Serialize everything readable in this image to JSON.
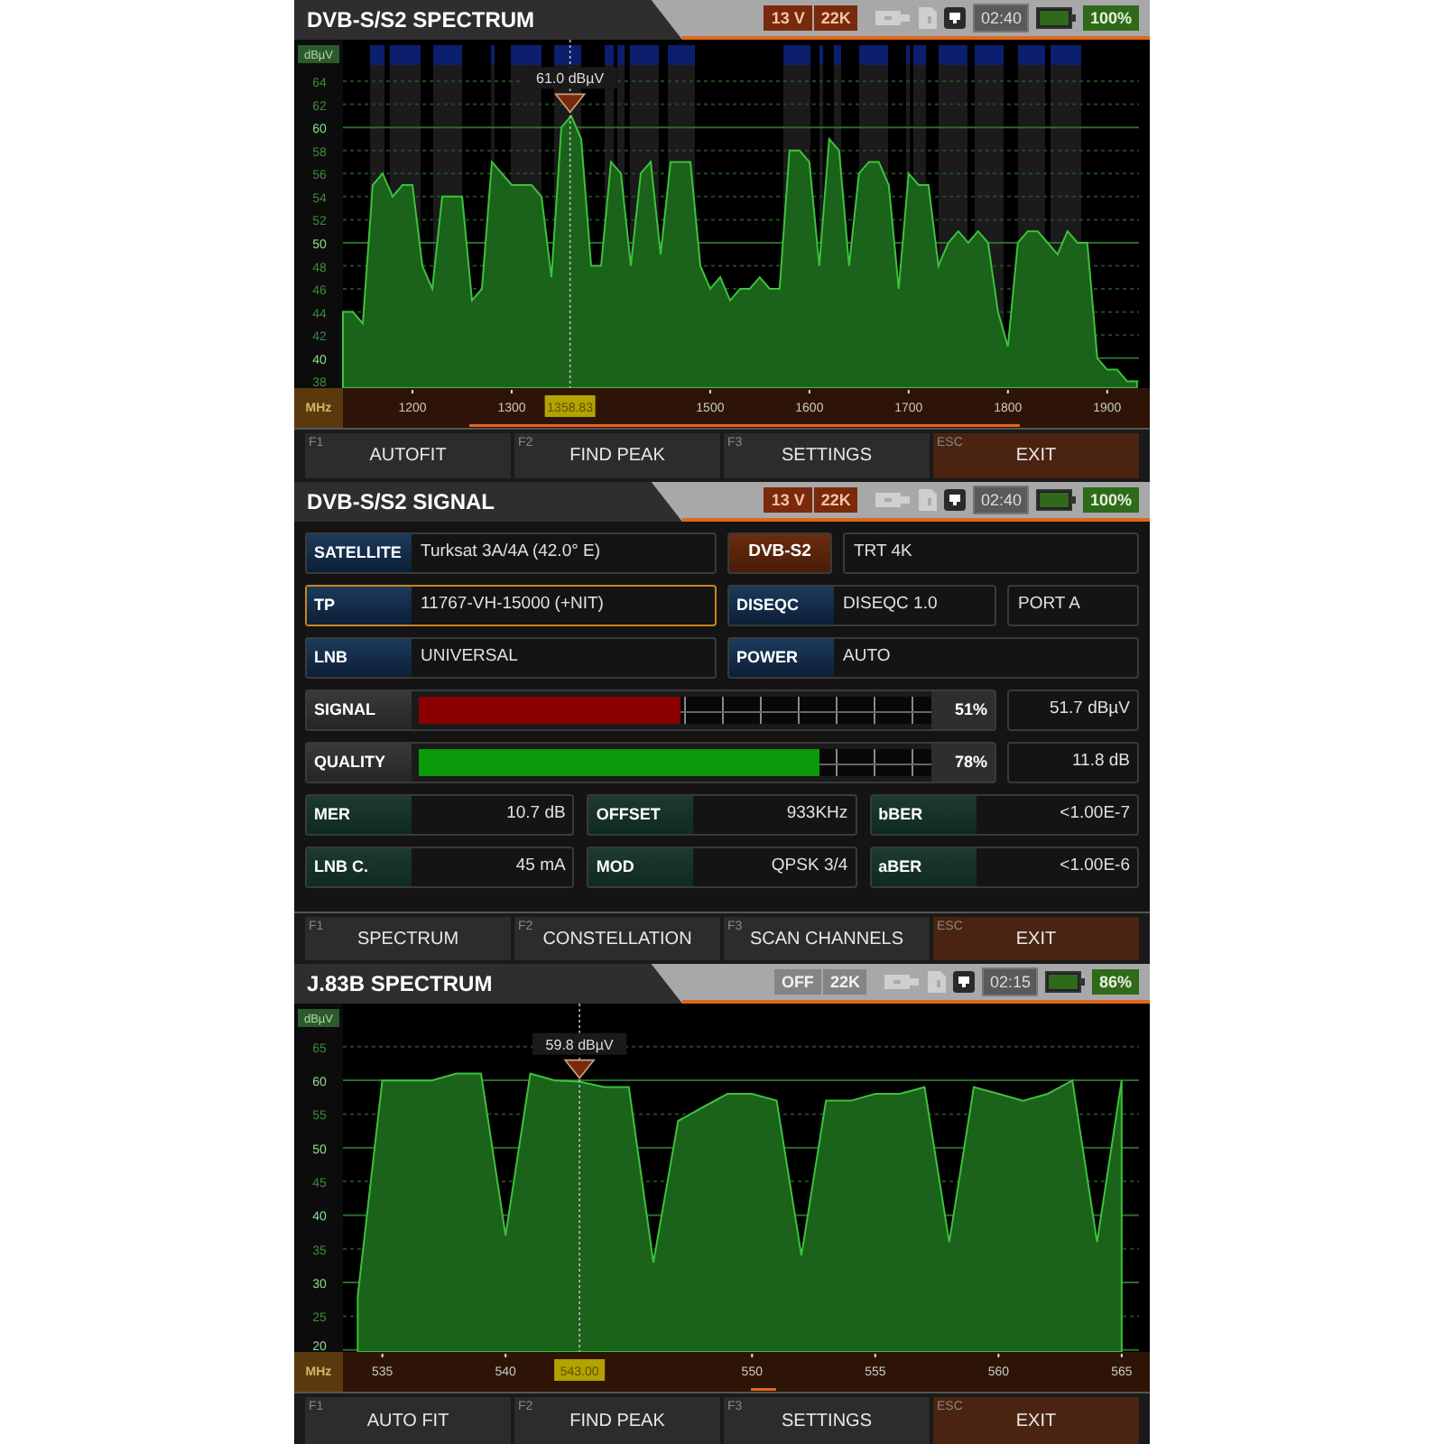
{
  "panels": [
    {
      "kind": "spectrum",
      "title": "DVB-S/S2 SPECTRUM",
      "status": {
        "badges": [
          {
            "text": "13 V",
            "on": true
          },
          {
            "text": "22K",
            "on": true
          }
        ],
        "time": "02:40",
        "battery": "100%"
      },
      "show_transponders": true,
      "cursor": "1358.83",
      "chart_data": {
        "type": "area",
        "ylabel": "dBµV",
        "xlabel": "MHz",
        "xlim": [
          1130,
          1932
        ],
        "ylim": [
          37.4,
          67.6
        ],
        "grid": true,
        "ref_lines": [
          {
            "axis": "x",
            "value": 1358.83
          }
        ],
        "xticks": [
          1200,
          1300,
          1500,
          1600,
          1700,
          1800,
          1900
        ],
        "yticks": [
          38,
          40,
          42,
          44,
          46,
          48,
          50,
          52,
          54,
          56,
          58,
          60,
          62,
          64
        ],
        "x": [
          1130,
          1140,
          1150,
          1160,
          1170,
          1180,
          1190,
          1200,
          1210,
          1220,
          1230,
          1240,
          1250,
          1260,
          1270,
          1280,
          1290,
          1300,
          1310,
          1320,
          1330,
          1340,
          1350,
          1360,
          1370,
          1380,
          1390,
          1400,
          1410,
          1420,
          1430,
          1440,
          1450,
          1460,
          1470,
          1480,
          1490,
          1500,
          1510,
          1520,
          1530,
          1540,
          1550,
          1560,
          1570,
          1580,
          1590,
          1600,
          1610,
          1620,
          1630,
          1640,
          1650,
          1660,
          1670,
          1680,
          1690,
          1700,
          1710,
          1720,
          1730,
          1740,
          1750,
          1760,
          1770,
          1780,
          1790,
          1800,
          1810,
          1820,
          1830,
          1840,
          1850,
          1860,
          1870,
          1880,
          1890,
          1900,
          1910,
          1920,
          1930
        ],
        "values": [
          44,
          44,
          43,
          55,
          56,
          54,
          55,
          55,
          48,
          46,
          54,
          54,
          54,
          45,
          46,
          57,
          56,
          55,
          55,
          55,
          54,
          47,
          60,
          61,
          59,
          48,
          48,
          57,
          56,
          48,
          56,
          57,
          49,
          57,
          57,
          57,
          48,
          46,
          47,
          45,
          46,
          46,
          47,
          46,
          46,
          58,
          58,
          57,
          48,
          59,
          58,
          48,
          56,
          57,
          57,
          55,
          46,
          56,
          55,
          55,
          48,
          50,
          51,
          50,
          51,
          50,
          44,
          41,
          50,
          51,
          51,
          50,
          49,
          51,
          50,
          50,
          40,
          39,
          39,
          38,
          38
        ],
        "annotations": [
          {
            "x": 1358.83,
            "y": 61.0,
            "text": "61.0 dBµV"
          }
        ]
      },
      "keys": [
        {
          "fkey": "F1",
          "label": "AUTOFIT",
          "kind": "function"
        },
        {
          "fkey": "F2",
          "label": "FIND PEAK",
          "kind": "function"
        },
        {
          "fkey": "F3",
          "label": "SETTINGS",
          "kind": "function"
        },
        {
          "fkey": "ESC",
          "label": "EXIT",
          "kind": "exit"
        }
      ]
    },
    {
      "kind": "signal",
      "title": "DVB-S/S2 SIGNAL",
      "status": {
        "badges": [
          {
            "text": "13 V",
            "on": true
          },
          {
            "text": "22K",
            "on": true
          }
        ],
        "time": "02:40",
        "battery": "100%"
      },
      "rows": [
        {
          "fields": [
            {
              "kind": "labeled",
              "label": "SATELLITE",
              "value": "Turksat 3A/4A (42.0° E)",
              "selected": false
            },
            {
              "kind": "chip",
              "label": "DVB-S2",
              "selected": false
            },
            {
              "kind": "plain",
              "value": "TRT 4K",
              "selected": false
            }
          ]
        },
        {
          "fields": [
            {
              "kind": "labeled",
              "label": "TP",
              "value": "11767-VH-15000 (+NIT)",
              "selected": true
            },
            {
              "kind": "labeled",
              "label": "DISEQC",
              "value": "DISEQC 1.0",
              "selected": false
            },
            {
              "kind": "plain",
              "value": "PORT A",
              "selected": false
            }
          ]
        },
        {
          "fields": [
            {
              "kind": "labeled",
              "label": "LNB",
              "value": "UNIVERSAL",
              "selected": false
            },
            {
              "kind": "labeled",
              "label": "POWER",
              "value": "AUTO",
              "selected": false
            }
          ]
        }
      ],
      "meters": [
        {
          "label": "SIGNAL",
          "level": 0.51,
          "color": "#8a0000",
          "percent": "51%",
          "reading": "51.7 dBµV"
        },
        {
          "label": "QUALITY",
          "level": 0.78,
          "color": "#0a9a0a",
          "percent": "78%",
          "reading": "11.8 dB"
        }
      ],
      "measurements": [
        {
          "label": "MER",
          "value": "10.7 dB"
        },
        {
          "label": "OFFSET",
          "value": "933KHz"
        },
        {
          "label": "bBER",
          "value": "<1.00E-7"
        },
        {
          "label": "LNB C.",
          "value": "45 mA"
        },
        {
          "label": "MOD",
          "value": "QPSK 3/4"
        },
        {
          "label": "aBER",
          "value": "<1.00E-6"
        }
      ],
      "keys": [
        {
          "fkey": "F1",
          "label": "SPECTRUM",
          "kind": "function"
        },
        {
          "fkey": "F2",
          "label": "CONSTELLATION",
          "kind": "function"
        },
        {
          "fkey": "F3",
          "label": "SCAN CHANNELS",
          "kind": "function"
        },
        {
          "fkey": "ESC",
          "label": "EXIT",
          "kind": "exit"
        }
      ]
    },
    {
      "kind": "spectrum",
      "title": "J.83B SPECTRUM",
      "status": {
        "badges": [
          {
            "text": "OFF",
            "on": false
          },
          {
            "text": "22K",
            "on": false
          }
        ],
        "time": "02:15",
        "battery": "86%"
      },
      "show_transponders": false,
      "cursor": "543.00",
      "chart_data": {
        "type": "area",
        "ylabel": "dBµV",
        "xlabel": "MHz",
        "xlim": [
          533.4,
          565.7
        ],
        "ylim": [
          19.7,
          71.4
        ],
        "grid": true,
        "ref_lines": [
          {
            "axis": "x",
            "value": 543.0
          }
        ],
        "xticks": [
          535,
          540,
          550,
          555,
          560,
          565
        ],
        "yticks": [
          20,
          25,
          30,
          35,
          40,
          45,
          50,
          55,
          60,
          65
        ],
        "x": [
          534,
          535,
          536,
          537,
          538,
          539,
          540,
          541,
          542,
          543,
          544,
          545,
          546,
          547,
          548,
          549,
          550,
          551,
          552,
          553,
          554,
          555,
          556,
          557,
          558,
          559,
          560,
          561,
          562,
          563,
          564,
          565
        ],
        "values": [
          28,
          60,
          60,
          60,
          61,
          61,
          37,
          61,
          60,
          59.8,
          59,
          59,
          33,
          54,
          56,
          58,
          58,
          57,
          34,
          57,
          57,
          58,
          58,
          59,
          36,
          59,
          58,
          57,
          58,
          60,
          36,
          60
        ],
        "annotations": [
          {
            "x": 543.0,
            "y": 59.8,
            "text": "59.8 dBµV"
          }
        ]
      },
      "keys": [
        {
          "fkey": "F1",
          "label": "AUTO FIT",
          "kind": "function"
        },
        {
          "fkey": "F2",
          "label": "FIND PEAK",
          "kind": "function"
        },
        {
          "fkey": "F3",
          "label": "SETTINGS",
          "kind": "function"
        },
        {
          "fkey": "ESC",
          "label": "EXIT",
          "kind": "exit"
        }
      ]
    }
  ]
}
